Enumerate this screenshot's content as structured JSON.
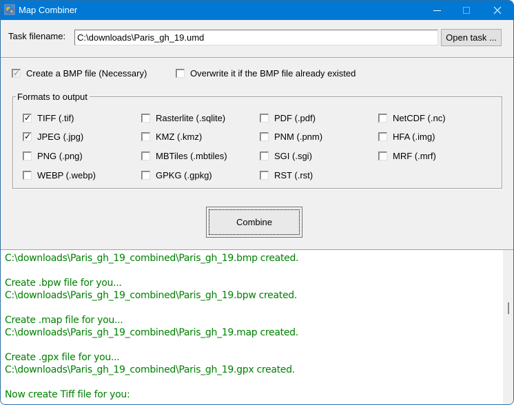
{
  "window": {
    "title": "Map Combiner",
    "app_icon": "globe-icon",
    "controls": {
      "minimize": "minimize-icon",
      "maximize": "maximize-icon",
      "close": "close-icon"
    }
  },
  "task": {
    "label": "Task filename:",
    "value": "C:\\downloads\\Paris_gh_19.umd",
    "open_button": "Open task ..."
  },
  "options": {
    "create_bmp": {
      "label": "Create a  BMP file (Necessary)",
      "checked": true,
      "disabled": true
    },
    "overwrite": {
      "label": "Overwrite it if the BMP file already existed",
      "checked": false
    }
  },
  "formats": {
    "title": "Formats to output",
    "items": [
      {
        "label": "TIFF (.tif)",
        "checked": true
      },
      {
        "label": "Rasterlite (.sqlite)",
        "checked": false
      },
      {
        "label": "PDF (.pdf)",
        "checked": false
      },
      {
        "label": "NetCDF (.nc)",
        "checked": false
      },
      {
        "label": "JPEG (.jpg)",
        "checked": true
      },
      {
        "label": "KMZ (.kmz)",
        "checked": false
      },
      {
        "label": "PNM (.pnm)",
        "checked": false
      },
      {
        "label": "HFA (.img)",
        "checked": false
      },
      {
        "label": "PNG (.png)",
        "checked": false
      },
      {
        "label": "MBTiles (.mbtiles)",
        "checked": false
      },
      {
        "label": "SGI (.sgi)",
        "checked": false
      },
      {
        "label": "MRF (.mrf)",
        "checked": false
      },
      {
        "label": "WEBP (.webp)",
        "checked": false
      },
      {
        "label": "GPKG (.gpkg)",
        "checked": false
      },
      {
        "label": "RST (.rst)",
        "checked": false
      }
    ]
  },
  "combine_button": "Combine",
  "log": {
    "color": "#008000",
    "lines": [
      "C:\\downloads\\Paris_gh_19_combined\\Paris_gh_19.bmp created.",
      "",
      "Create .bpw file for you...",
      "C:\\downloads\\Paris_gh_19_combined\\Paris_gh_19.bpw created.",
      "",
      "Create .map file for you...",
      "C:\\downloads\\Paris_gh_19_combined\\Paris_gh_19.map created.",
      "",
      "Create .gpx file for you...",
      "C:\\downloads\\Paris_gh_19_combined\\Paris_gh_19.gpx created.",
      "",
      "Now create Tiff file for you:"
    ]
  }
}
